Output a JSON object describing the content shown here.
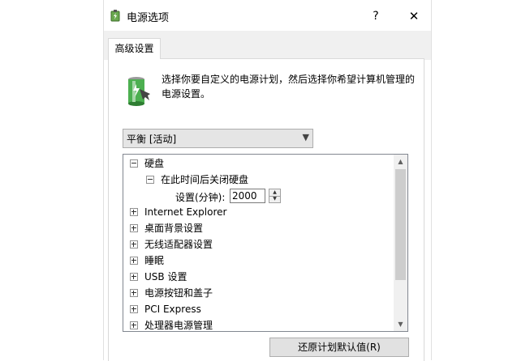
{
  "window": {
    "title": "电源选项",
    "help_label": "?",
    "close_label": "✕"
  },
  "tabs": [
    {
      "label": "高级设置"
    }
  ],
  "description": "选择你要自定义的电源计划，然后选择你希望计算机管理的电源设置。",
  "plan_select": {
    "value": "平衡 [活动]"
  },
  "tree": {
    "items": [
      {
        "label": "硬盘",
        "expanded": true
      },
      {
        "label": "在此时间后关闭硬盘",
        "expanded": true
      },
      {
        "label": "Internet Explorer",
        "expanded": false
      },
      {
        "label": "桌面背景设置",
        "expanded": false
      },
      {
        "label": "无线适配器设置",
        "expanded": false
      },
      {
        "label": "睡眠",
        "expanded": false
      },
      {
        "label": "USB 设置",
        "expanded": false
      },
      {
        "label": "电源按钮和盖子",
        "expanded": false
      },
      {
        "label": "PCI Express",
        "expanded": false
      },
      {
        "label": "处理器电源管理",
        "expanded": false
      }
    ],
    "setting": {
      "label": "设置(分钟):",
      "value": "2000"
    }
  },
  "buttons": {
    "restore_defaults": "还原计划默认值(R)"
  },
  "colors": {
    "dialog_bg": "#ffffff",
    "tab_strip_bg": "#f0f0f0",
    "button_bg": "#e1e1e1",
    "scroll_thumb": "#cdcdcd"
  }
}
